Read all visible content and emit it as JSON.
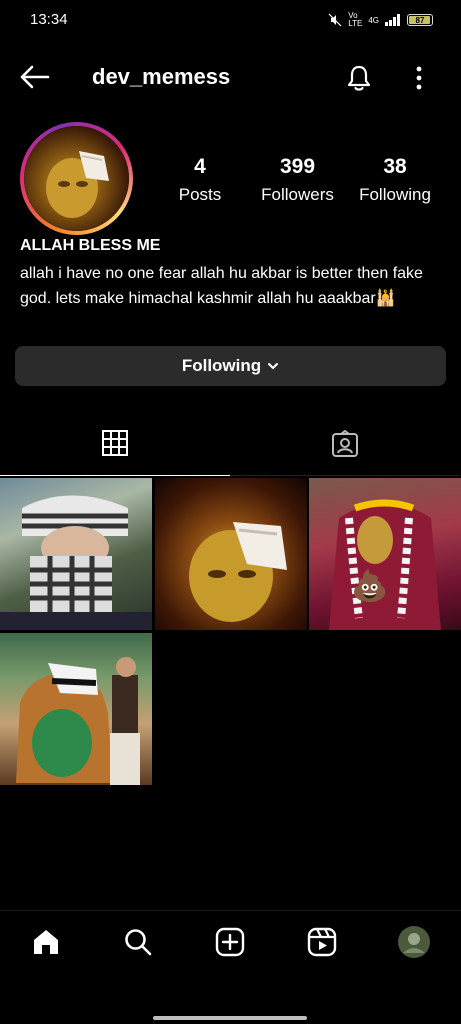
{
  "status_bar": {
    "time": "13:34",
    "network": "4G",
    "battery_level": "87"
  },
  "header": {
    "username": "dev_memess",
    "back_icon": "arrow-left-icon",
    "bell_icon": "bell-icon",
    "more_icon": "more-vertical-icon"
  },
  "profile": {
    "stats": [
      {
        "count": "4",
        "label": "Posts"
      },
      {
        "count": "399",
        "label": "Followers"
      },
      {
        "count": "38",
        "label": "Following"
      }
    ],
    "bio_name": "ALLAH BLESS ME",
    "bio_text": "allah i have no one fear allah hu akbar is better then fake god. lets make himachal kashmir allah hu aaakbar🕌"
  },
  "actions": {
    "following_label": "Following"
  },
  "tabs": [
    {
      "name": "posts-grid",
      "icon": "grid-icon",
      "active": true
    },
    {
      "name": "tagged",
      "icon": "tagged-person-icon",
      "active": false
    }
  ],
  "posts": [
    {
      "overlay_emoji": ""
    },
    {
      "overlay_emoji": ""
    },
    {
      "overlay_emoji": "💩"
    },
    {
      "overlay_emoji": ""
    }
  ],
  "bottom_nav": [
    {
      "icon": "home-icon"
    },
    {
      "icon": "search-icon"
    },
    {
      "icon": "add-post-icon"
    },
    {
      "icon": "reels-icon"
    },
    {
      "icon": "profile-avatar-icon"
    }
  ],
  "colors": {
    "background": "#000000",
    "button_bg": "#2b2b2b",
    "text": "#ffffff"
  }
}
